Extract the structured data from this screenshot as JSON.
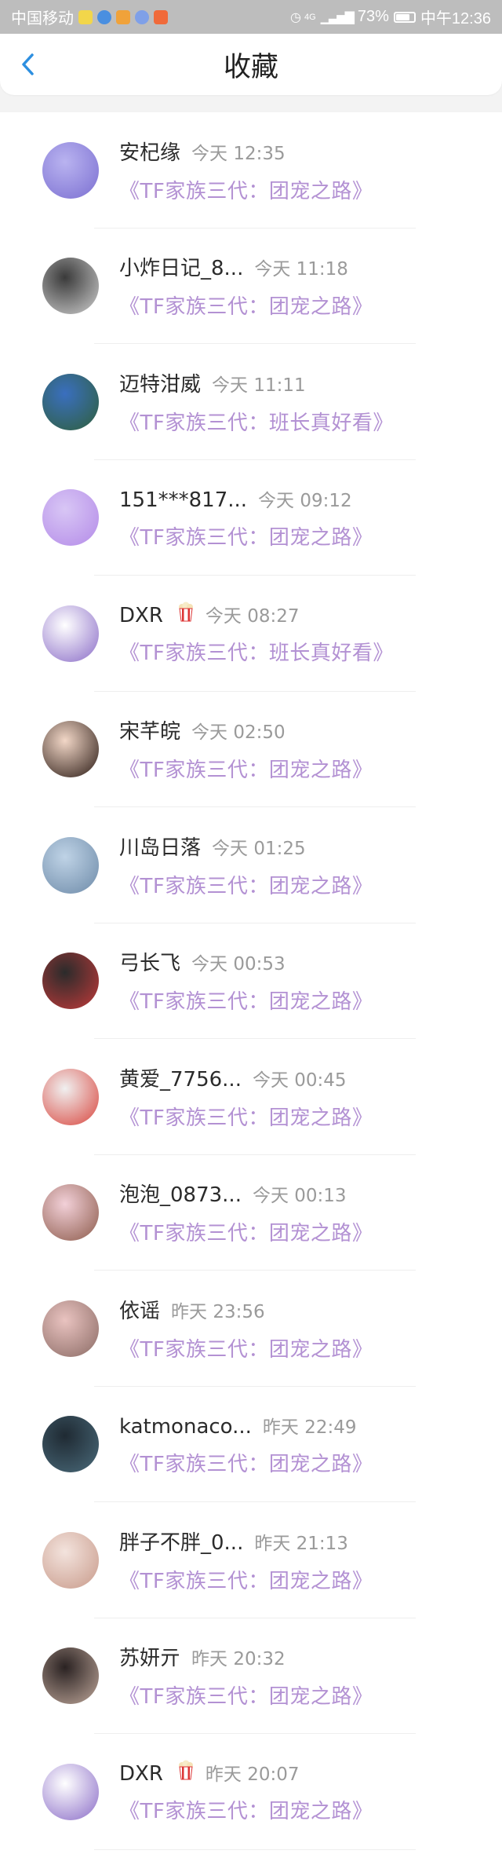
{
  "status_bar": {
    "carrier": "中国移动",
    "network": "4G",
    "battery": "73%",
    "time": "中午12:36"
  },
  "header": {
    "title": "收藏"
  },
  "items": [
    {
      "name": "安杞缘",
      "time": "今天 12:35",
      "subtitle": "《TF家族三代：团宠之路》",
      "avatar_colors": [
        "#b9b3f0",
        "#7b6fd1"
      ],
      "popcorn": false
    },
    {
      "name": "小炸日记_8...",
      "time": "今天 11:18",
      "subtitle": "《TF家族三代：团宠之路》",
      "avatar_colors": [
        "#3a3a3a",
        "#cfcfcf"
      ],
      "popcorn": false
    },
    {
      "name": "迈特泔威",
      "time": "今天 11:11",
      "subtitle": "《TF家族三代：班长真好看》",
      "avatar_colors": [
        "#3a6fbf",
        "#2f5f3a"
      ],
      "popcorn": false
    },
    {
      "name": "151***817...",
      "time": "今天 09:12",
      "subtitle": "《TF家族三代：团宠之路》",
      "avatar_colors": [
        "#d8c6f5",
        "#b48be8"
      ],
      "popcorn": false
    },
    {
      "name": "DXR",
      "time": "今天 08:27",
      "subtitle": "《TF家族三代：班长真好看》",
      "avatar_colors": [
        "#ffffff",
        "#8a6cc7"
      ],
      "popcorn": true
    },
    {
      "name": "宋芊皖",
      "time": "今天 02:50",
      "subtitle": "《TF家族三代：团宠之路》",
      "avatar_colors": [
        "#f2d7c7",
        "#2a1a14"
      ],
      "popcorn": false
    },
    {
      "name": "川岛日落",
      "time": "今天 01:25",
      "subtitle": "《TF家族三代：团宠之路》",
      "avatar_colors": [
        "#bfd3e6",
        "#6d8aa8"
      ],
      "popcorn": false
    },
    {
      "name": "弓长飞",
      "time": "今天 00:53",
      "subtitle": "《TF家族三代：团宠之路》",
      "avatar_colors": [
        "#2b2b2b",
        "#c23a3a"
      ],
      "popcorn": false
    },
    {
      "name": "黄爱_7756...",
      "time": "今天 00:45",
      "subtitle": "《TF家族三代：团宠之路》",
      "avatar_colors": [
        "#f0f0f0",
        "#d9463e"
      ],
      "popcorn": false
    },
    {
      "name": "泡泡_0873...",
      "time": "今天 00:13",
      "subtitle": "《TF家族三代：团宠之路》",
      "avatar_colors": [
        "#f2d0d8",
        "#8c5a4a"
      ],
      "popcorn": false
    },
    {
      "name": "依谣",
      "time": "昨天 23:56",
      "subtitle": "《TF家族三代：团宠之路》",
      "avatar_colors": [
        "#e9c3c0",
        "#8a6a64"
      ],
      "popcorn": false
    },
    {
      "name": "katmonaco...",
      "time": "昨天 22:49",
      "subtitle": "《TF家族三代：团宠之路》",
      "avatar_colors": [
        "#1f2a33",
        "#4a6a7a"
      ],
      "popcorn": false
    },
    {
      "name": "胖子不胖_0...",
      "time": "昨天 21:13",
      "subtitle": "《TF家族三代：团宠之路》",
      "avatar_colors": [
        "#f3e3dd",
        "#c89a8a"
      ],
      "popcorn": false
    },
    {
      "name": "苏妍亓",
      "time": "昨天 20:32",
      "subtitle": "《TF家族三代：团宠之路》",
      "avatar_colors": [
        "#2a2222",
        "#bfa79a"
      ],
      "popcorn": false
    },
    {
      "name": "DXR",
      "time": "昨天 20:07",
      "subtitle": "《TF家族三代：团宠之路》",
      "avatar_colors": [
        "#ffffff",
        "#8a6cc7"
      ],
      "popcorn": true
    }
  ],
  "colors": {
    "accent_purple": "#b391d3",
    "back_arrow": "#2d8fe0"
  }
}
